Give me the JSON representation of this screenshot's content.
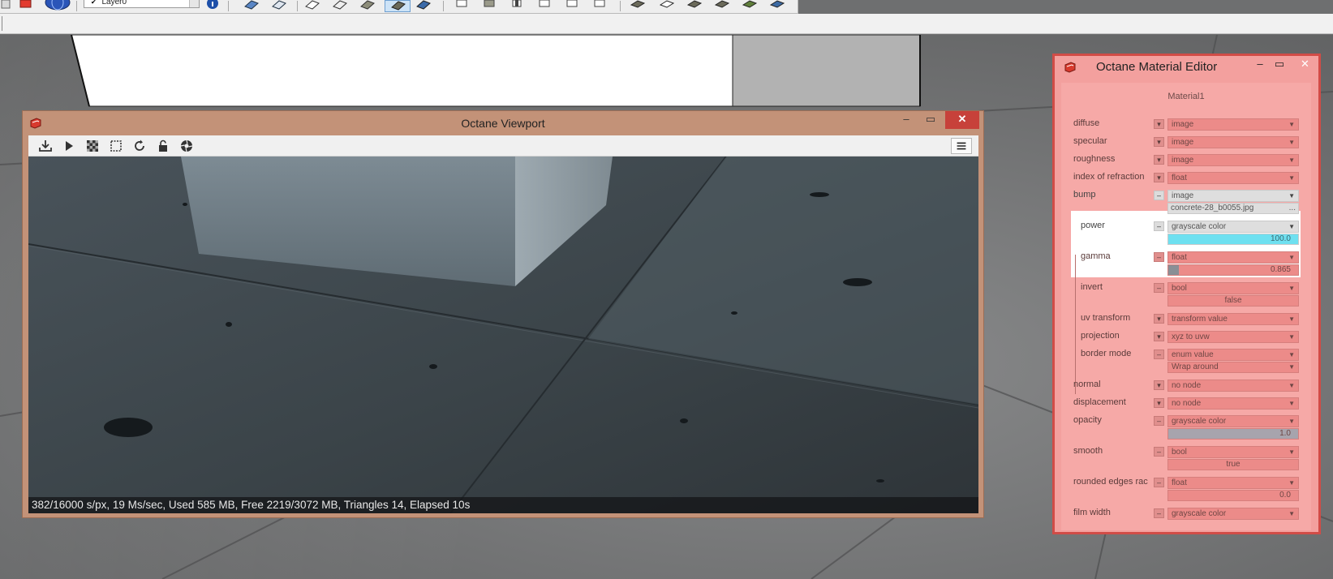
{
  "toolbar": {
    "layer_select_value": "Layer0",
    "icons": [
      "eraser-icon",
      "paint-bucket-icon",
      "globe-icon",
      "layer-icon",
      "info-icon",
      "section-plane-icon",
      "section-plane-icon-2",
      "face-style-icon",
      "wireframe-icon",
      "hidden-line-icon",
      "shaded-icon",
      "shaded-texture-icon",
      "monochrome-icon",
      "iso-view-icon",
      "top-view-icon",
      "front-view-icon",
      "right-view-icon",
      "back-view-icon",
      "left-view-icon",
      "sandbox-icon",
      "sandbox-icon-2",
      "sandbox-icon-3",
      "sandbox-icon-4",
      "sandbox-icon-5",
      "sandbox-icon-6",
      "sandbox-icon-7"
    ]
  },
  "viewport": {
    "title": "Octane Viewport",
    "toolbar_icons": [
      "download-icon",
      "play-icon",
      "checkerboard-icon",
      "region-select-icon",
      "refresh-icon",
      "lock-icon",
      "aperture-icon"
    ],
    "status": "382/16000 s/px, 19 Ms/sec, Used 585 MB, Free 2219/3072 MB, Triangles 14, Elapsed 10s"
  },
  "material_editor": {
    "title": "Octane Material Editor",
    "material_name": "Material1",
    "params": [
      {
        "label": "diffuse",
        "toggle": "▾",
        "type": "image"
      },
      {
        "label": "specular",
        "toggle": "▾",
        "type": "image"
      },
      {
        "label": "roughness",
        "toggle": "▾",
        "type": "image"
      },
      {
        "label": "index of refraction",
        "toggle": "▾",
        "type": "float"
      },
      {
        "label": "bump",
        "toggle": "–",
        "type": "image",
        "value": "concrete-28_b0055.jpg",
        "value_button": "..."
      },
      {
        "label": "power",
        "toggle": "–",
        "type": "grayscale color",
        "value": "100.0",
        "fill": 1.0
      },
      {
        "label": "gamma",
        "toggle": "–",
        "type": "float",
        "value": "0.865",
        "fill": 0.08
      },
      {
        "label": "invert",
        "toggle": "–",
        "type": "bool",
        "value": "false"
      },
      {
        "label": "uv transform",
        "toggle": "▾",
        "type": "transform value"
      },
      {
        "label": "projection",
        "toggle": "▾",
        "type": "xyz to uvw"
      },
      {
        "label": "border mode",
        "toggle": "–",
        "type": "enum value",
        "value": "Wrap around"
      },
      {
        "label": "normal",
        "toggle": "▾",
        "type": "no node"
      },
      {
        "label": "displacement",
        "toggle": "▾",
        "type": "no node"
      },
      {
        "label": "opacity",
        "toggle": "–",
        "type": "grayscale color",
        "value": "1.0",
        "fill": 1.0
      },
      {
        "label": "smooth",
        "toggle": "–",
        "type": "bool",
        "value": "true"
      },
      {
        "label": "rounded edges rac",
        "toggle": "–",
        "type": "float",
        "value": "0.0"
      },
      {
        "label": "film width",
        "toggle": "–",
        "type": "grayscale color"
      }
    ]
  },
  "colors": {
    "editor_bg": "#f3a09e",
    "editor_border": "#d14c47",
    "viewport_frame": "#c39278",
    "power_fill": "#6ee0f0",
    "opacity_fill": "#a7a4ad",
    "gamma_fill": "#8a8f96"
  }
}
